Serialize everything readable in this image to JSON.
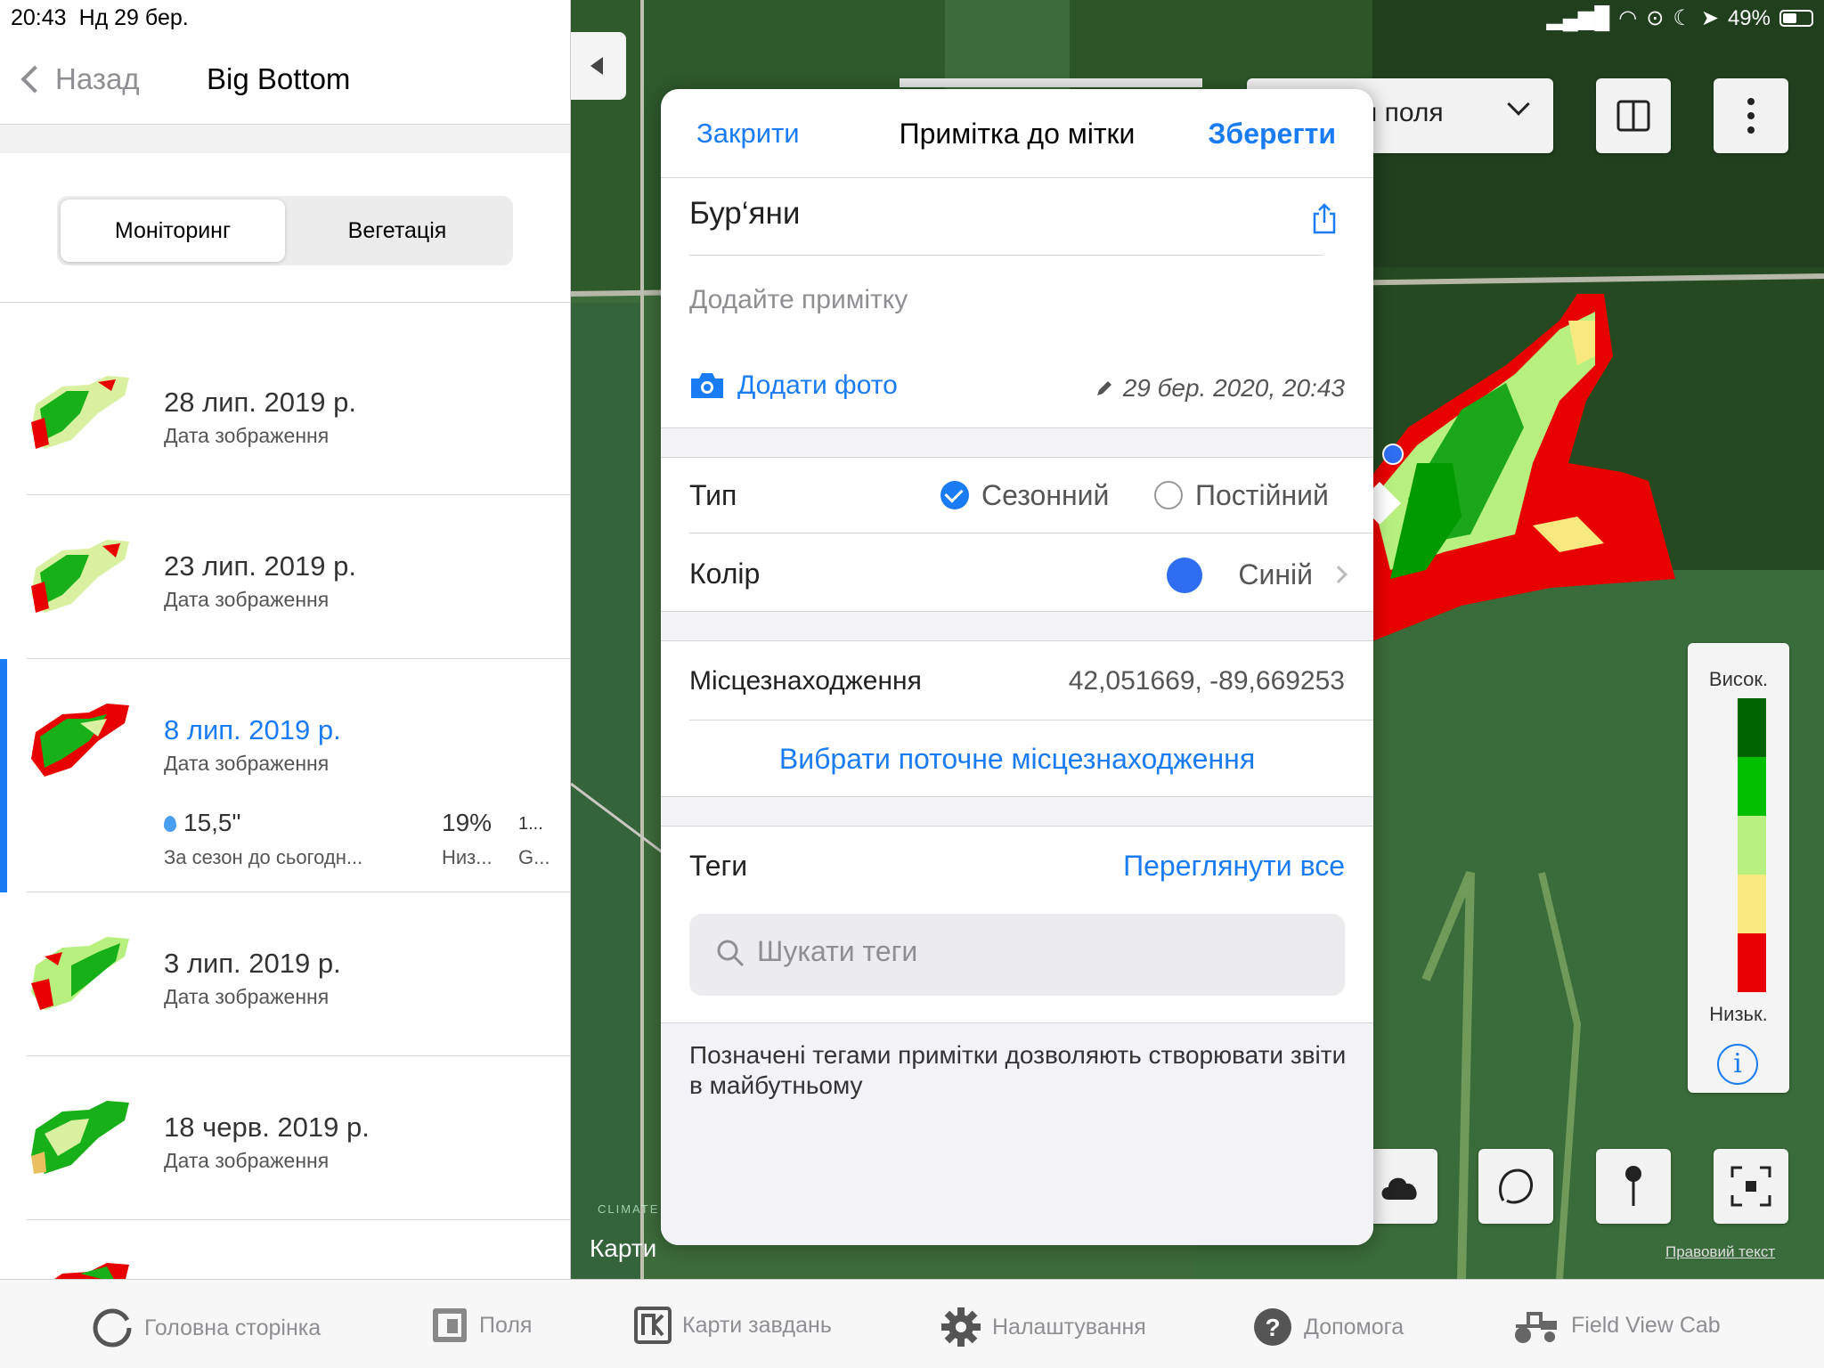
{
  "status": {
    "time": "20:43",
    "date": "Нд 29 бер.",
    "battery": "49%"
  },
  "nav": {
    "back_label": "Назад",
    "title": "Big Bottom"
  },
  "segments": [
    "Моніторинг",
    "Вегетація"
  ],
  "images": [
    {
      "date": "28 лип. 2019 р.",
      "subtitle": "Дата зображення"
    },
    {
      "date": "23 лип. 2019 р.",
      "subtitle": "Дата зображення"
    },
    {
      "date": "8 лип. 2019 р.",
      "subtitle": "Дата зображення",
      "stats": [
        {
          "value": "15,5\"",
          "label": "За сезон до сьогодн..."
        },
        {
          "value": "19%",
          "label": "Низ..."
        },
        {
          "value": "1...",
          "label": "G..."
        }
      ]
    },
    {
      "date": "3 лип. 2019 р.",
      "subtitle": "Дата зображення"
    },
    {
      "date": "18 черв. 2019 р.",
      "subtitle": "Дата зображення"
    }
  ],
  "map": {
    "field_select": "я поля",
    "legend_high": "Висок.",
    "legend_low": "Низьк.",
    "legend_colors": [
      "#006400",
      "#00c000",
      "#b8f080",
      "#f8e880",
      "#e80000"
    ],
    "legal": "Правовий текст",
    "maps_label": "Карти",
    "climate": "CLIMATE"
  },
  "popover": {
    "close": "Закрити",
    "title": "Примітка до мітки",
    "save": "Зберегти",
    "note_title": "Бур‘яни",
    "note_placeholder": "Додайте примітку",
    "add_photo": "Додати фото",
    "edited": "29 бер. 2020, 20:43",
    "type_label": "Тип",
    "type_option_1": "Сезонний",
    "type_option_2": "Постійний",
    "color_label": "Колір",
    "color_value": "Синій",
    "location_label": "Місцезнаходження",
    "location_value": "42,051669, -89,669253",
    "select_location": "Вибрати поточне місцезнаходження",
    "tags_label": "Теги",
    "view_all": "Переглянути все",
    "search_placeholder": "Шукати теги",
    "footer": "Позначені тегами примітки дозволяють створювати звіти в майбутньому"
  },
  "tabs": [
    {
      "label": "Головна сторінка",
      "icon": "home-ring-icon"
    },
    {
      "label": "Поля",
      "icon": "fields-icon"
    },
    {
      "label": "Карти завдань",
      "icon": "task-map-icon"
    },
    {
      "label": "Налаштування",
      "icon": "gear-icon"
    },
    {
      "label": "Допомога",
      "icon": "help-icon"
    },
    {
      "label": "Field View Cab",
      "icon": "tractor-icon"
    }
  ]
}
